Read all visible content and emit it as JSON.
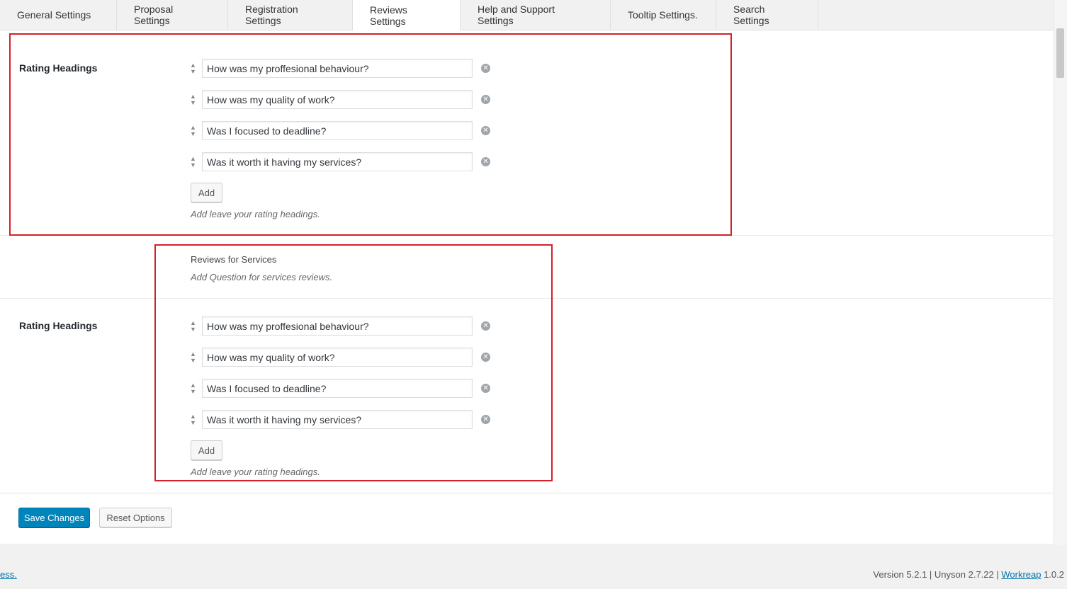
{
  "tabs": [
    {
      "label": "General Settings"
    },
    {
      "label": "Proposal Settings"
    },
    {
      "label": "Registration Settings"
    },
    {
      "label": "Reviews Settings"
    },
    {
      "label": "Help and Support Settings"
    },
    {
      "label": "Tooltip Settings."
    },
    {
      "label": "Search Settings"
    }
  ],
  "active_tab": "Reviews Settings",
  "rating_block_1": {
    "label": "Rating Headings",
    "items": [
      "How was my proffesional behaviour?",
      "How was my quality of work?",
      "Was I focused to deadline?",
      "Was it worth it having my services?"
    ],
    "add_label": "Add",
    "description": "Add leave your rating headings."
  },
  "services_section": {
    "title": "Reviews for Services",
    "description": "Add Question for services reviews."
  },
  "rating_block_2": {
    "label": "Rating Headings",
    "items": [
      "How was my proffesional behaviour?",
      "How was my quality of work?",
      "Was I focused to deadline?",
      "Was it worth it having my services?"
    ],
    "add_label": "Add",
    "description": "Add leave your rating headings."
  },
  "actions": {
    "save_label": "Save Changes",
    "reset_label": "Reset Options"
  },
  "footer": {
    "left_link": "ess.",
    "version_text": "Version 5.2.1 | Unyson 2.7.22 | ",
    "brand_link": "Workreap",
    "brand_version": " 1.0.2"
  },
  "colors": {
    "highlight": "#d42127",
    "primary_button": "#0085ba"
  }
}
